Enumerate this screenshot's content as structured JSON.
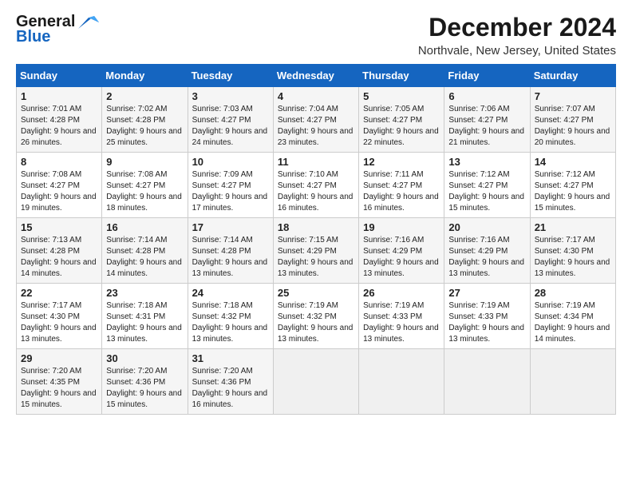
{
  "header": {
    "logo_line1": "General",
    "logo_line2": "Blue",
    "title": "December 2024",
    "subtitle": "Northvale, New Jersey, United States"
  },
  "weekdays": [
    "Sunday",
    "Monday",
    "Tuesday",
    "Wednesday",
    "Thursday",
    "Friday",
    "Saturday"
  ],
  "weeks": [
    [
      {
        "day": "1",
        "sunrise": "Sunrise: 7:01 AM",
        "sunset": "Sunset: 4:28 PM",
        "daylight": "Daylight: 9 hours and 26 minutes."
      },
      {
        "day": "2",
        "sunrise": "Sunrise: 7:02 AM",
        "sunset": "Sunset: 4:28 PM",
        "daylight": "Daylight: 9 hours and 25 minutes."
      },
      {
        "day": "3",
        "sunrise": "Sunrise: 7:03 AM",
        "sunset": "Sunset: 4:27 PM",
        "daylight": "Daylight: 9 hours and 24 minutes."
      },
      {
        "day": "4",
        "sunrise": "Sunrise: 7:04 AM",
        "sunset": "Sunset: 4:27 PM",
        "daylight": "Daylight: 9 hours and 23 minutes."
      },
      {
        "day": "5",
        "sunrise": "Sunrise: 7:05 AM",
        "sunset": "Sunset: 4:27 PM",
        "daylight": "Daylight: 9 hours and 22 minutes."
      },
      {
        "day": "6",
        "sunrise": "Sunrise: 7:06 AM",
        "sunset": "Sunset: 4:27 PM",
        "daylight": "Daylight: 9 hours and 21 minutes."
      },
      {
        "day": "7",
        "sunrise": "Sunrise: 7:07 AM",
        "sunset": "Sunset: 4:27 PM",
        "daylight": "Daylight: 9 hours and 20 minutes."
      }
    ],
    [
      {
        "day": "8",
        "sunrise": "Sunrise: 7:08 AM",
        "sunset": "Sunset: 4:27 PM",
        "daylight": "Daylight: 9 hours and 19 minutes."
      },
      {
        "day": "9",
        "sunrise": "Sunrise: 7:08 AM",
        "sunset": "Sunset: 4:27 PM",
        "daylight": "Daylight: 9 hours and 18 minutes."
      },
      {
        "day": "10",
        "sunrise": "Sunrise: 7:09 AM",
        "sunset": "Sunset: 4:27 PM",
        "daylight": "Daylight: 9 hours and 17 minutes."
      },
      {
        "day": "11",
        "sunrise": "Sunrise: 7:10 AM",
        "sunset": "Sunset: 4:27 PM",
        "daylight": "Daylight: 9 hours and 16 minutes."
      },
      {
        "day": "12",
        "sunrise": "Sunrise: 7:11 AM",
        "sunset": "Sunset: 4:27 PM",
        "daylight": "Daylight: 9 hours and 16 minutes."
      },
      {
        "day": "13",
        "sunrise": "Sunrise: 7:12 AM",
        "sunset": "Sunset: 4:27 PM",
        "daylight": "Daylight: 9 hours and 15 minutes."
      },
      {
        "day": "14",
        "sunrise": "Sunrise: 7:12 AM",
        "sunset": "Sunset: 4:27 PM",
        "daylight": "Daylight: 9 hours and 15 minutes."
      }
    ],
    [
      {
        "day": "15",
        "sunrise": "Sunrise: 7:13 AM",
        "sunset": "Sunset: 4:28 PM",
        "daylight": "Daylight: 9 hours and 14 minutes."
      },
      {
        "day": "16",
        "sunrise": "Sunrise: 7:14 AM",
        "sunset": "Sunset: 4:28 PM",
        "daylight": "Daylight: 9 hours and 14 minutes."
      },
      {
        "day": "17",
        "sunrise": "Sunrise: 7:14 AM",
        "sunset": "Sunset: 4:28 PM",
        "daylight": "Daylight: 9 hours and 13 minutes."
      },
      {
        "day": "18",
        "sunrise": "Sunrise: 7:15 AM",
        "sunset": "Sunset: 4:29 PM",
        "daylight": "Daylight: 9 hours and 13 minutes."
      },
      {
        "day": "19",
        "sunrise": "Sunrise: 7:16 AM",
        "sunset": "Sunset: 4:29 PM",
        "daylight": "Daylight: 9 hours and 13 minutes."
      },
      {
        "day": "20",
        "sunrise": "Sunrise: 7:16 AM",
        "sunset": "Sunset: 4:29 PM",
        "daylight": "Daylight: 9 hours and 13 minutes."
      },
      {
        "day": "21",
        "sunrise": "Sunrise: 7:17 AM",
        "sunset": "Sunset: 4:30 PM",
        "daylight": "Daylight: 9 hours and 13 minutes."
      }
    ],
    [
      {
        "day": "22",
        "sunrise": "Sunrise: 7:17 AM",
        "sunset": "Sunset: 4:30 PM",
        "daylight": "Daylight: 9 hours and 13 minutes."
      },
      {
        "day": "23",
        "sunrise": "Sunrise: 7:18 AM",
        "sunset": "Sunset: 4:31 PM",
        "daylight": "Daylight: 9 hours and 13 minutes."
      },
      {
        "day": "24",
        "sunrise": "Sunrise: 7:18 AM",
        "sunset": "Sunset: 4:32 PM",
        "daylight": "Daylight: 9 hours and 13 minutes."
      },
      {
        "day": "25",
        "sunrise": "Sunrise: 7:19 AM",
        "sunset": "Sunset: 4:32 PM",
        "daylight": "Daylight: 9 hours and 13 minutes."
      },
      {
        "day": "26",
        "sunrise": "Sunrise: 7:19 AM",
        "sunset": "Sunset: 4:33 PM",
        "daylight": "Daylight: 9 hours and 13 minutes."
      },
      {
        "day": "27",
        "sunrise": "Sunrise: 7:19 AM",
        "sunset": "Sunset: 4:33 PM",
        "daylight": "Daylight: 9 hours and 13 minutes."
      },
      {
        "day": "28",
        "sunrise": "Sunrise: 7:19 AM",
        "sunset": "Sunset: 4:34 PM",
        "daylight": "Daylight: 9 hours and 14 minutes."
      }
    ],
    [
      {
        "day": "29",
        "sunrise": "Sunrise: 7:20 AM",
        "sunset": "Sunset: 4:35 PM",
        "daylight": "Daylight: 9 hours and 15 minutes."
      },
      {
        "day": "30",
        "sunrise": "Sunrise: 7:20 AM",
        "sunset": "Sunset: 4:36 PM",
        "daylight": "Daylight: 9 hours and 15 minutes."
      },
      {
        "day": "31",
        "sunrise": "Sunrise: 7:20 AM",
        "sunset": "Sunset: 4:36 PM",
        "daylight": "Daylight: 9 hours and 16 minutes."
      },
      null,
      null,
      null,
      null
    ]
  ]
}
